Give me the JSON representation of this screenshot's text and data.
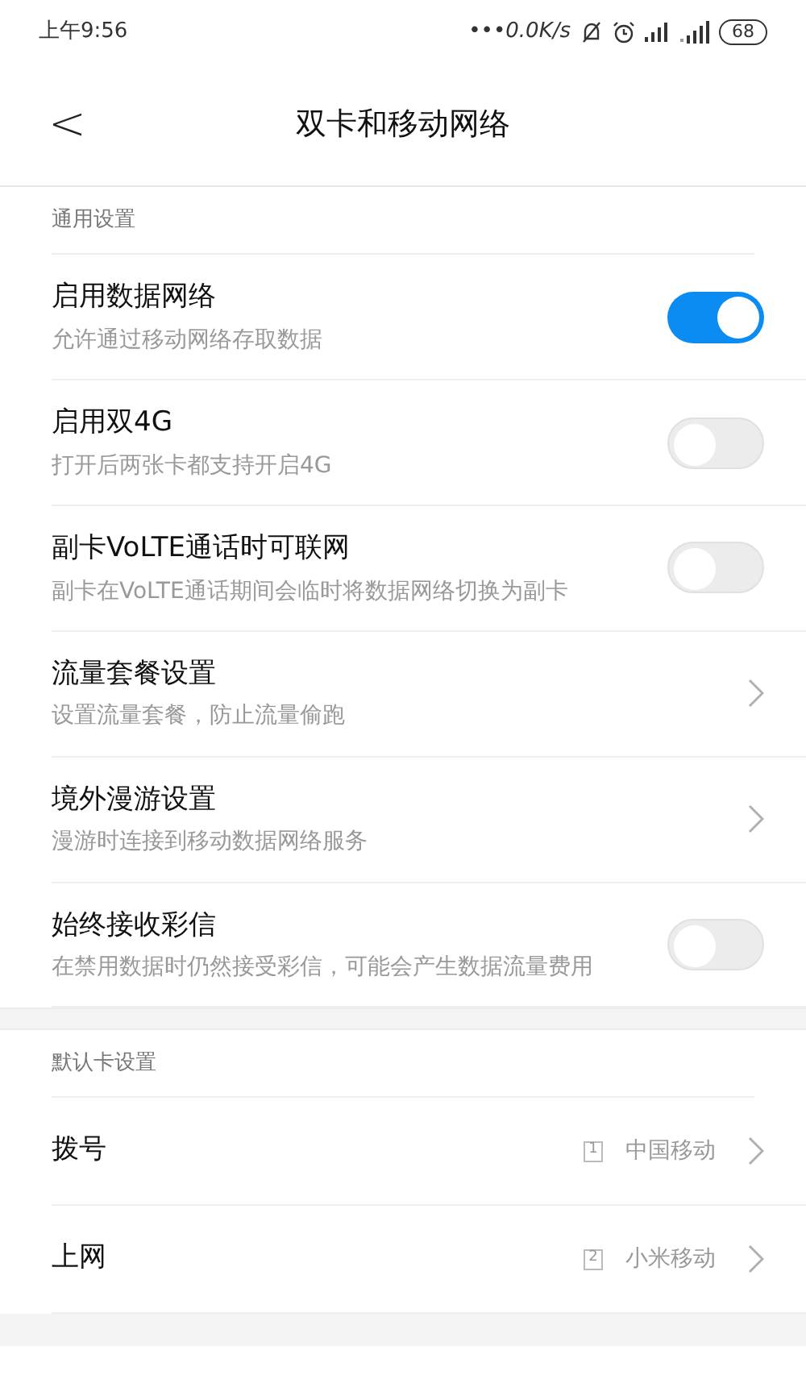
{
  "status_bar": {
    "time": "上午9:56",
    "speed": "•••0.0K/s",
    "battery": "68"
  },
  "header": {
    "back": "<",
    "title": "双卡和移动网络"
  },
  "sections": [
    {
      "title": "通用设置",
      "items": [
        {
          "kind": "toggle",
          "title": "启用数据网络",
          "subtitle": "允许通过移动网络存取数据",
          "on": true
        },
        {
          "kind": "toggle",
          "title": "启用双4G",
          "subtitle": "打开后两张卡都支持开启4G",
          "on": false
        },
        {
          "kind": "toggle",
          "title": "副卡VoLTE通话时可联网",
          "subtitle": "副卡在VoLTE通话期间会临时将数据网络切换为副卡",
          "on": false
        },
        {
          "kind": "link",
          "title": "流量套餐设置",
          "subtitle": "设置流量套餐，防止流量偷跑"
        },
        {
          "kind": "link",
          "title": "境外漫游设置",
          "subtitle": "漫游时连接到移动数据网络服务"
        },
        {
          "kind": "toggle",
          "title": "始终接收彩信",
          "subtitle": "在禁用数据时仍然接受彩信，可能会产生数据流量费用",
          "on": false
        }
      ]
    },
    {
      "title": "默认卡设置",
      "items": [
        {
          "kind": "sim",
          "title": "拨号",
          "sim": "1",
          "value": "中国移动"
        },
        {
          "kind": "sim",
          "title": "上网",
          "sim": "2",
          "value": "小米移动"
        }
      ]
    }
  ]
}
